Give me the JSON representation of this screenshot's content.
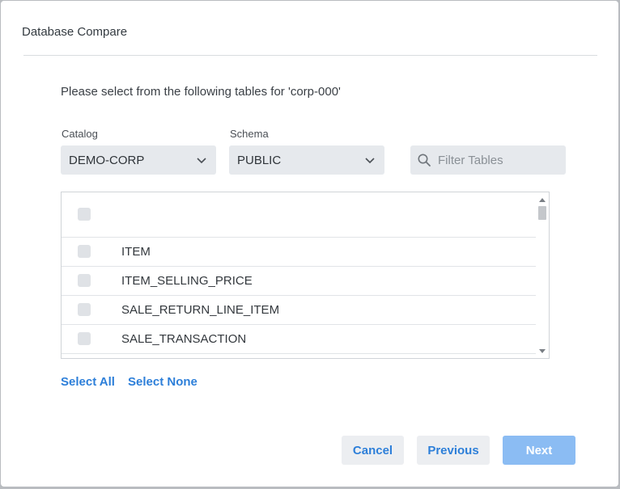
{
  "dialog": {
    "title": "Database Compare",
    "prompt": "Please select from the following tables for 'corp-000'"
  },
  "catalog": {
    "label": "Catalog",
    "value": "DEMO-CORP"
  },
  "schema": {
    "label": "Schema",
    "value": "PUBLIC"
  },
  "filter": {
    "placeholder": "Filter Tables",
    "value": ""
  },
  "tables": {
    "rows": [
      {
        "name": "ITEM",
        "checked": false
      },
      {
        "name": "ITEM_SELLING_PRICE",
        "checked": false
      },
      {
        "name": "SALE_RETURN_LINE_ITEM",
        "checked": false
      },
      {
        "name": "SALE_TRANSACTION",
        "checked": false
      }
    ]
  },
  "links": {
    "select_all": "Select All",
    "select_none": "Select None"
  },
  "buttons": {
    "cancel": "Cancel",
    "previous": "Previous",
    "next": "Next"
  },
  "colors": {
    "accent": "#2d7fd9",
    "primary_disabled": "#8bbcf3",
    "field_bg": "#e6e9ed"
  }
}
